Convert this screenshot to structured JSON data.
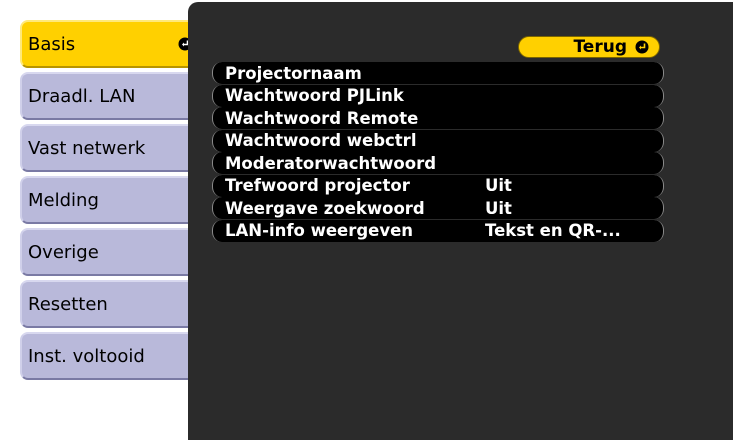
{
  "menu": {
    "items": [
      {
        "label": "Basis",
        "active": true
      },
      {
        "label": "Draadl. LAN"
      },
      {
        "label": "Vast netwerk"
      },
      {
        "label": "Melding"
      },
      {
        "label": "Overige"
      },
      {
        "label": "Resetten"
      },
      {
        "label": "Inst. voltooid"
      }
    ]
  },
  "panel": {
    "back_label": "Terug",
    "settings": [
      {
        "name": "Projectornaam",
        "value": ""
      },
      {
        "name": "Wachtwoord PJLink",
        "value": ""
      },
      {
        "name": "Wachtwoord Remote",
        "value": ""
      },
      {
        "name": "Wachtwoord webctrl",
        "value": ""
      },
      {
        "name": "Moderatorwachtwoord",
        "value": ""
      },
      {
        "name": "Trefwoord projector",
        "value": "Uit"
      },
      {
        "name": "Weergave zoekwoord",
        "value": "Uit"
      },
      {
        "name": "LAN-info weergeven",
        "value": "Tekst en QR-..."
      }
    ]
  },
  "colors": {
    "accent": "#ffd000",
    "menu_item": "#b9b9da",
    "panel": "#2b2b2b",
    "row": "#000000"
  },
  "icons": {
    "enter": "enter-return-icon"
  }
}
